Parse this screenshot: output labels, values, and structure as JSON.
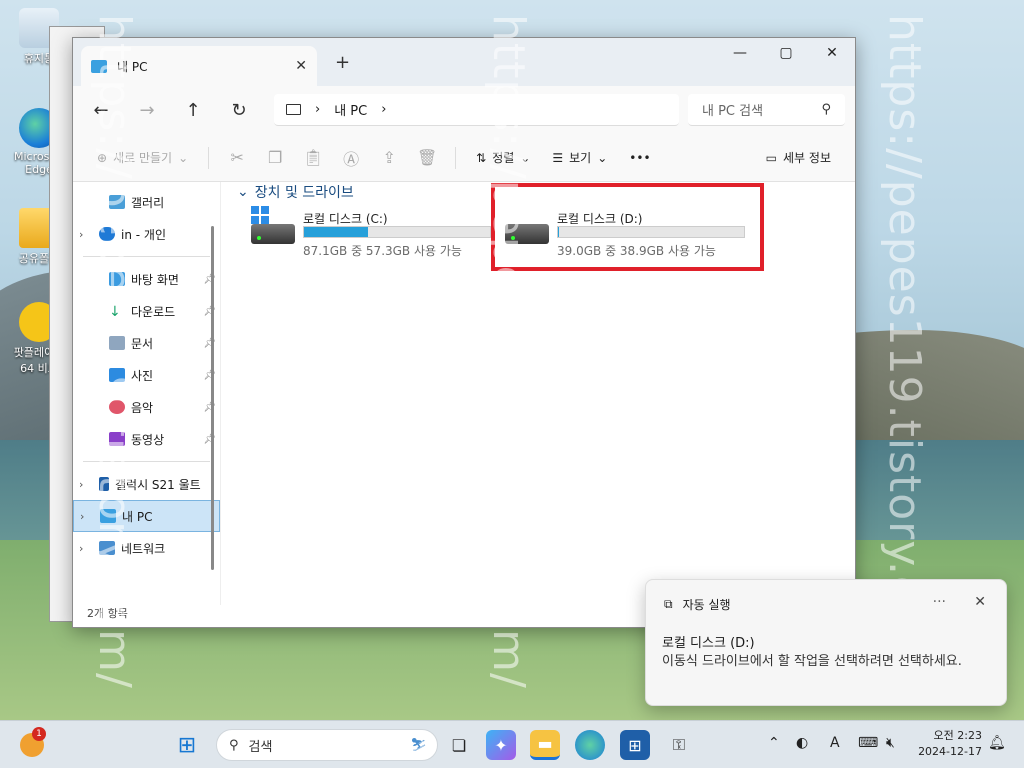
{
  "desktop": {
    "icons": [
      {
        "label": "휴지통",
        "icon": "recycle-bin-icon"
      },
      {
        "label": "Microsoft Edge",
        "icon": "edge-icon"
      },
      {
        "label": "공유폴더",
        "icon": "folder-icon"
      },
      {
        "label": "팟플레이어 64 비트",
        "icon": "potplayer-icon"
      }
    ],
    "watermarks": [
      "https://pepes119.tistory.com/",
      "https://pepes119.tistory.com/",
      "https://pepes119.tistory.com/"
    ]
  },
  "explorer": {
    "tab_title": "내 PC",
    "new_tab": "+",
    "window_controls": {
      "minimize": "—",
      "maximize": "▢",
      "close": "✕"
    },
    "breadcrumb": [
      "내 PC"
    ],
    "search_placeholder": "내 PC 검색",
    "toolbar": {
      "new": "새로 만들기",
      "sort": "정렬",
      "view": "보기",
      "more": "•••",
      "details": "세부 정보"
    },
    "sidebar": {
      "items": [
        {
          "label": "갤러리",
          "icon": "gallery-icon",
          "pinned": false
        },
        {
          "label": "in - 개인",
          "icon": "onedrive-icon",
          "pinned": false
        },
        {
          "label": "바탕 화면",
          "icon": "desktop-icon",
          "pinned": true
        },
        {
          "label": "다운로드",
          "icon": "download-icon",
          "pinned": true
        },
        {
          "label": "문서",
          "icon": "documents-icon",
          "pinned": true
        },
        {
          "label": "사진",
          "icon": "pictures-icon",
          "pinned": true
        },
        {
          "label": "음악",
          "icon": "music-icon",
          "pinned": true
        },
        {
          "label": "동영상",
          "icon": "videos-icon",
          "pinned": true
        },
        {
          "label": "갤럭시 S21 울트",
          "icon": "phone-icon",
          "pinned": false
        },
        {
          "label": "내 PC",
          "icon": "pc-icon",
          "pinned": false
        },
        {
          "label": "네트워크",
          "icon": "network-icon",
          "pinned": false
        }
      ]
    },
    "section_title": "장치 및 드라이브",
    "drives": [
      {
        "name": "로컬 디스크 (C:)",
        "info": "87.1GB 중 57.3GB 사용 가능",
        "used_fraction": 0.342
      },
      {
        "name": "로컬 디스크 (D:)",
        "info": "39.0GB 중 38.9GB 사용 가능",
        "used_fraction": 0.003
      }
    ],
    "status": "2개 항목"
  },
  "toast": {
    "app": "자동 실행",
    "title": "로컬 디스크 (D:)",
    "message": "이동식 드라이브에서 할 작업을 선택하려면 선택하세요.",
    "more": "···",
    "close": "✕"
  },
  "taskbar": {
    "search": "검색",
    "time": "오전 2:23",
    "date": "2024-12-17",
    "badge": "1"
  },
  "colors": {
    "accent": "#26a0da",
    "highlight_box": "#e0202a",
    "selected": "#cce4f7"
  }
}
